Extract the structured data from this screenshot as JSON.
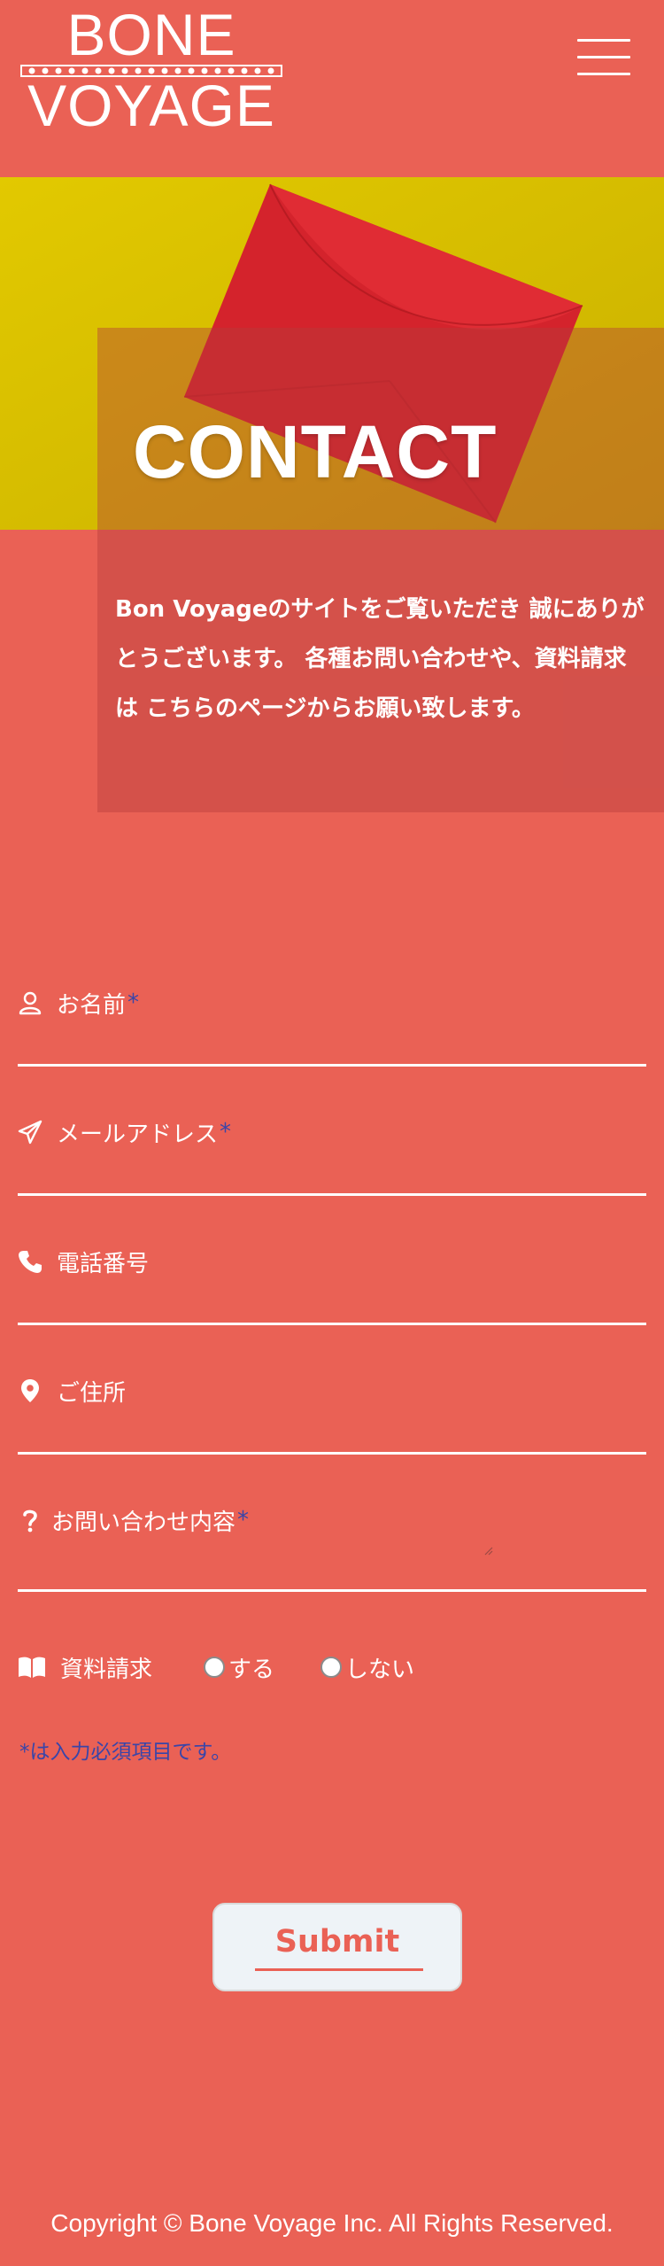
{
  "header": {
    "logo_line1": "BONE",
    "logo_line2": "VOYAGE"
  },
  "hero": {
    "title": "CONTACT",
    "intro": "Bon Voyageのサイトをご覧いただき 誠にありがとうございます。 各種お問い合わせや、資料請求は こちらのページからお願い致します。"
  },
  "form": {
    "required_mark": "*",
    "name": {
      "label": "お名前",
      "icon": "user-icon"
    },
    "email": {
      "label": "メールアドレス",
      "icon": "paper-plane-icon"
    },
    "phone": {
      "label": "電話番号",
      "icon": "phone-icon"
    },
    "address": {
      "label": "ご住所",
      "icon": "map-marker-icon"
    },
    "inquiry": {
      "label": "お問い合わせ内容",
      "icon": "question-icon"
    },
    "brochure": {
      "label": "資料請求",
      "icon": "book-icon",
      "options": [
        "する",
        "しない"
      ]
    },
    "note": "*は入力必須項目です。",
    "submit_label": "Submit"
  },
  "footer": {
    "copyright": "Copyright © Bone Voyage Inc. All Rights Reserved."
  },
  "colors": {
    "background": "#ea6155",
    "required": "#3a45a8",
    "hero_yellow": "#d9c100",
    "envelope_red": "#d4232c"
  }
}
